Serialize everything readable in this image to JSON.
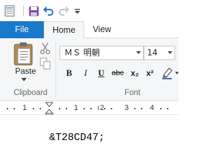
{
  "quick_access": {
    "items": [
      "save-icon",
      "undo-icon",
      "redo-icon",
      "customize-icon"
    ]
  },
  "tabs": [
    {
      "label": "File"
    },
    {
      "label": "Home"
    },
    {
      "label": "View"
    }
  ],
  "clipboard": {
    "paste_label": "Paste",
    "group_label": "Clipboard"
  },
  "font": {
    "family": "ＭＳ 明朝",
    "size": "14",
    "group_label": "Font",
    "bold_label": "B",
    "italic_label": "I",
    "underline_label": "U",
    "strike_label": "abc",
    "subscript_label": "x₂",
    "superscript_label": "x²"
  },
  "ruler": {
    "numbers": [
      "1",
      "1",
      "2",
      "3",
      "4"
    ]
  },
  "document": {
    "text": "&T28CD47;"
  },
  "colors": {
    "file_tab": "#1979ca",
    "ribbon_bg": "#f5f6f7",
    "accent_blue": "#2b579a"
  }
}
